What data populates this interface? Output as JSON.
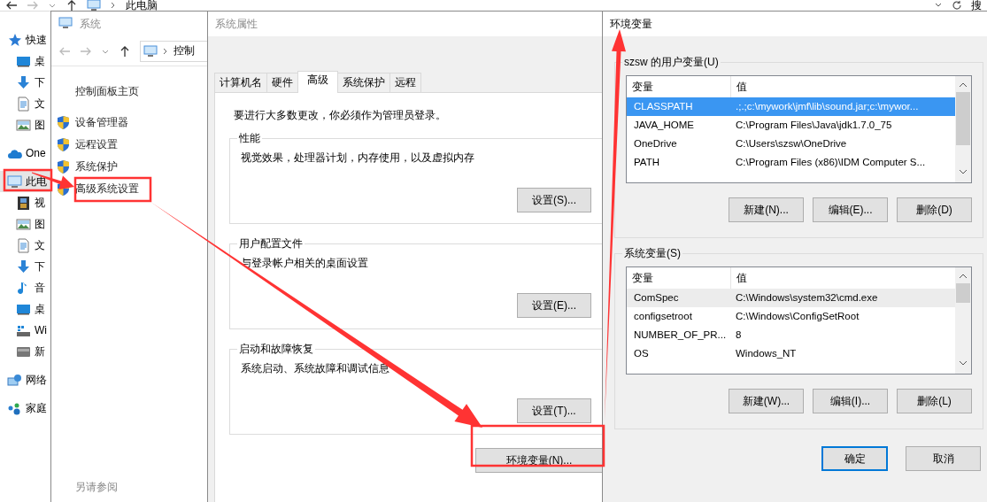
{
  "explorer": {
    "breadcrumb": "此电脑",
    "search_label": "搜",
    "sidebar": [
      {
        "label": "快速",
        "kind": "star",
        "selected": false,
        "children": [
          {
            "label": "桌",
            "kind": "desktop",
            "selected": false
          },
          {
            "label": "下",
            "kind": "download",
            "selected": false
          },
          {
            "label": "文",
            "kind": "document",
            "selected": false
          },
          {
            "label": "图",
            "kind": "image",
            "selected": false
          }
        ]
      },
      {
        "label": "One",
        "kind": "cloud",
        "selected": false
      },
      {
        "label": "此电",
        "kind": "computer",
        "selected": true,
        "children": [
          {
            "label": "视",
            "kind": "video",
            "selected": false
          },
          {
            "label": "图",
            "kind": "image",
            "selected": false
          },
          {
            "label": "文",
            "kind": "document",
            "selected": false
          },
          {
            "label": "下",
            "kind": "download",
            "selected": false
          },
          {
            "label": "音",
            "kind": "music",
            "selected": false
          },
          {
            "label": "桌",
            "kind": "desktop",
            "selected": false
          },
          {
            "label": "Wi",
            "kind": "windrive",
            "selected": false
          },
          {
            "label": "新",
            "kind": "drive",
            "selected": false
          }
        ]
      },
      {
        "label": "网络",
        "kind": "network",
        "selected": false
      },
      {
        "label": "家庭",
        "kind": "homegroup",
        "selected": false
      }
    ]
  },
  "system_window": {
    "title": "系统",
    "breadcrumb": "控制",
    "links": [
      {
        "label": "控制面板主页",
        "kind": "plain"
      },
      {
        "label": "设备管理器",
        "kind": "shield"
      },
      {
        "label": "远程设置",
        "kind": "shield"
      },
      {
        "label": "系统保护",
        "kind": "shield"
      },
      {
        "label": "高级系统设置",
        "kind": "shield"
      }
    ],
    "see_also": "另请参阅"
  },
  "system_properties": {
    "title": "系统属性",
    "tabs": [
      {
        "label": "计算机名",
        "selected": false
      },
      {
        "label": "硬件",
        "selected": false
      },
      {
        "label": "高级",
        "selected": true
      },
      {
        "label": "系统保护",
        "selected": false
      },
      {
        "label": "远程",
        "selected": false
      }
    ],
    "notice": "要进行大多数更改，你必须作为管理员登录。",
    "groups": [
      {
        "title": "性能",
        "description": "视觉效果，处理器计划，内存使用，以及虚拟内存",
        "button": "设置(S)..."
      },
      {
        "title": "用户配置文件",
        "description": "与登录帐户相关的桌面设置",
        "button": "设置(E)..."
      },
      {
        "title": "启动和故障恢复",
        "description": "系统启动、系统故障和调试信息",
        "button": "设置(T)..."
      }
    ],
    "env_button": "环境变量(N)..."
  },
  "environment_variables": {
    "title": "环境变量",
    "user_vars": {
      "title": "szsw 的用户变量(U)",
      "focused": true,
      "columns": [
        "变量",
        "值"
      ],
      "rows": [
        {
          "name": "CLASSPATH",
          "value": ".;.;c:\\mywork\\jmf\\lib\\sound.jar;c:\\mywor...",
          "selected": true
        },
        {
          "name": "JAVA_HOME",
          "value": "C:\\Program Files\\Java\\jdk1.7.0_75",
          "selected": false
        },
        {
          "name": "OneDrive",
          "value": "C:\\Users\\szsw\\OneDrive",
          "selected": false
        },
        {
          "name": "PATH",
          "value": "C:\\Program Files (x86)\\IDM Computer S...",
          "selected": false
        }
      ],
      "buttons": [
        "新建(N)...",
        "编辑(E)...",
        "删除(D)"
      ]
    },
    "system_vars": {
      "title": "系统变量(S)",
      "focused": false,
      "columns": [
        "变量",
        "值"
      ],
      "rows": [
        {
          "name": "ComSpec",
          "value": "C:\\Windows\\system32\\cmd.exe",
          "selected": true
        },
        {
          "name": "configsetroot",
          "value": "C:\\Windows\\ConfigSetRoot",
          "selected": false
        },
        {
          "name": "NUMBER_OF_PR...",
          "value": "8",
          "selected": false
        },
        {
          "name": "OS",
          "value": "Windows_NT",
          "selected": false
        }
      ],
      "buttons": [
        "新建(W)...",
        "编辑(I)...",
        "删除(L)"
      ]
    },
    "buttons": [
      {
        "label": "确定",
        "focused": true
      },
      {
        "label": "取消",
        "focused": false
      }
    ]
  }
}
